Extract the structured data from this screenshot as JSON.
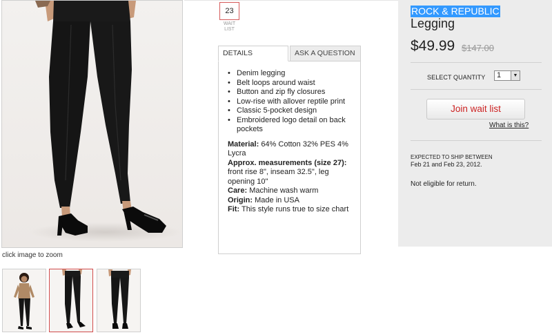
{
  "gallery": {
    "zoom_hint": "click image to zoom"
  },
  "wait_list": {
    "count": "23",
    "label": "WAIT LIST"
  },
  "tabs": {
    "details": "DETAILS",
    "ask": "ASK A QUESTION"
  },
  "details": {
    "bullets": [
      "Denim legging",
      "Belt loops around waist",
      "Button and zip fly closures",
      "Low-rise with allover reptile print",
      "Classic 5-pocket design",
      "Embroidered logo detail on back pockets"
    ],
    "specs": [
      {
        "label": "Material:",
        "value": "64% Cotton 32% PES 4% Lycra"
      },
      {
        "label": "Approx. measurements (size 27):",
        "value": "front rise 8\", inseam 32.5\", leg opening 10\""
      },
      {
        "label": "Care:",
        "value": "Machine wash warm"
      },
      {
        "label": "Origin:",
        "value": "Made in USA"
      },
      {
        "label": "Fit:",
        "value": "This style runs true to size chart"
      }
    ]
  },
  "product": {
    "brand": "ROCK & REPUBLIC",
    "name": "Legging",
    "price": "$49.99",
    "original_price": "$147.00"
  },
  "purchase": {
    "quantity_label": "SELECT QUANTITY",
    "quantity_value": "1",
    "join_button": "Join wait list",
    "what_link": "What is this?"
  },
  "shipping": {
    "label": "EXPECTED TO SHIP BETWEEN",
    "dates": "Feb 21 and Feb 23, 2012.",
    "returns": "Not eligible for return."
  },
  "colors": {
    "selection_highlight": "#3399ff",
    "accent_red": "#cc2222",
    "panel_bg": "#ececec"
  }
}
